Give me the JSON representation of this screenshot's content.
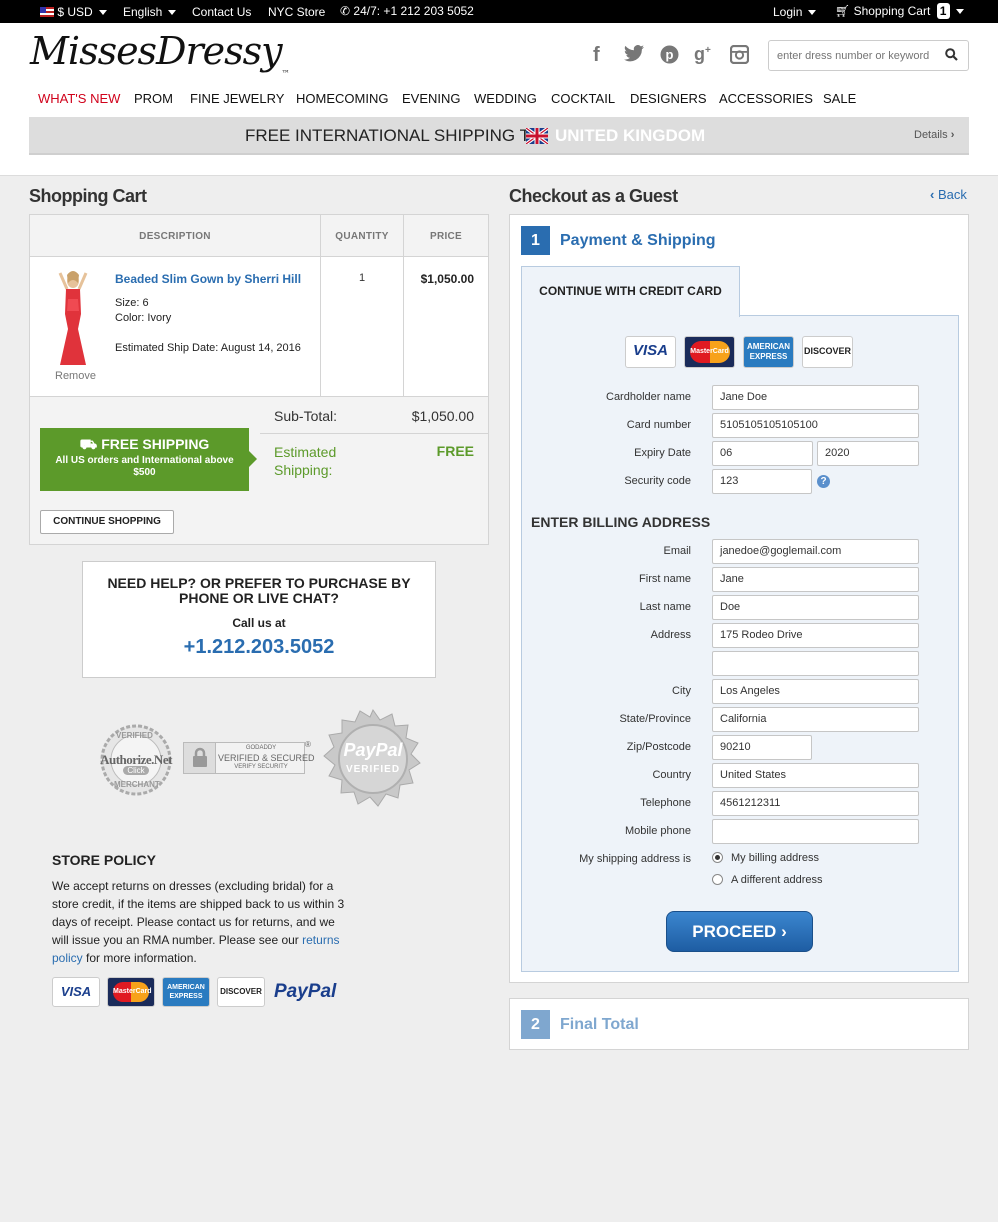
{
  "topbar": {
    "currency": "$ USD",
    "language": "English",
    "contact": "Contact Us",
    "store": "NYC Store",
    "phone": "24/7: +1 212 203 5052",
    "login": "Login",
    "cart_label": "Shopping Cart",
    "cart_count": "1"
  },
  "header": {
    "logo": "MissesDressy",
    "trademark": "™",
    "search_placeholder": "enter dress number or keyword"
  },
  "nav": [
    "WHAT'S NEW",
    "PROM",
    "FINE JEWELRY",
    "HOMECOMING",
    "EVENING",
    "WEDDING",
    "COCKTAIL",
    "DESIGNERS",
    "ACCESSORIES",
    "SALE"
  ],
  "banner": {
    "text": "FREE INTERNATIONAL SHIPPING TO",
    "country": "UNITED KINGDOM",
    "details": "Details"
  },
  "cart": {
    "title": "Shopping Cart",
    "headers": [
      "DESCRIPTION",
      "QUANTITY",
      "PRICE"
    ],
    "item": {
      "name": "Beaded Slim Gown by Sherri Hill",
      "size": "Size: 6",
      "color": "Color: Ivory",
      "ship": "Estimated Ship Date: August 14, 2016",
      "remove": "Remove",
      "quantity": "1",
      "price": "$1,050.00"
    },
    "subtotal_label": "Sub-Total:",
    "subtotal": "$1,050.00",
    "shipping_label_1": "Estimated",
    "shipping_label_2": "Shipping:",
    "shipping_value": "FREE",
    "free_shipping_title": "FREE SHIPPING",
    "free_shipping_sub": "All US orders and International above $500",
    "continue": "CONTINUE SHOPPING"
  },
  "help": {
    "title": "NEED HELP? OR PREFER TO PURCHASE BY PHONE OR LIVE CHAT?",
    "call": "Call us at",
    "phone": "+1.212.203.5052"
  },
  "badges": {
    "authorize": "Authorize.Net",
    "authorize_top": "VERIFIED",
    "authorize_mid": "Click",
    "authorize_bottom": "MERCHANT",
    "godaddy_1": "GODADDY",
    "godaddy_2": "VERIFIED & SECURED",
    "godaddy_3": "VERIFY SECURITY",
    "paypal": "PayPal",
    "paypal_sub": "VERIFIED"
  },
  "policy": {
    "title": "STORE POLICY",
    "text": "We accept returns on dresses (excluding bridal) for a store credit, if the items are shipped back to us within 3 days of receipt. Please contact us for returns, and we will issue you an RMA number. Please see our",
    "link": "returns policy",
    "tail": "for more information."
  },
  "cards": {
    "visa": "VISA",
    "mastercard": "MasterCard",
    "amex": "AMERICAN EXPRESS",
    "discover": "DISCOVER",
    "paypal": "PayPal"
  },
  "checkout": {
    "title": "Checkout as a Guest",
    "back": "Back",
    "step1_num": "1",
    "step1": "Payment & Shipping",
    "tab": "CONTINUE WITH CREDIT CARD",
    "billing_title": "ENTER BILLING ADDRESS",
    "step2_num": "2",
    "step2": "Final Total",
    "proceed": "PROCEED"
  },
  "form": {
    "cardholder_label": "Cardholder name",
    "cardholder": "Jane Doe",
    "card_label": "Card number",
    "card": "5105105105105100",
    "expiry_label": "Expiry Date",
    "exp_month": "06",
    "exp_year": "2020",
    "cvv_label": "Security code",
    "cvv": "123",
    "email_label": "Email",
    "email": "janedoe@goglemail.com",
    "first_label": "First name",
    "first": "Jane",
    "last_label": "Last name",
    "last": "Doe",
    "address_label": "Address",
    "address": "175 Rodeo Drive",
    "address2": "",
    "city_label": "City",
    "city": "Los Angeles",
    "state_label": "State/Province",
    "state": "California",
    "zip_label": "Zip/Postcode",
    "zip": "90210",
    "country_label": "Country",
    "country": "United States",
    "phone_label": "Telephone",
    "phone": "4561212311",
    "mobile_label": "Mobile phone",
    "mobile": "",
    "ship_label": "My shipping address is",
    "ship_opt1": "My billing address",
    "ship_opt2": "A different address"
  },
  "colors": {
    "accent": "#2a6db0",
    "green": "#5c9a2a",
    "red": "#d0021b",
    "step_blue": "#2a6db0"
  }
}
